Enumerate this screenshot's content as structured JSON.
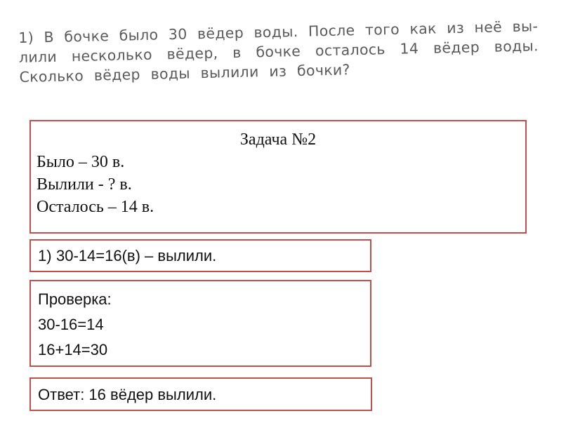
{
  "problem_text": {
    "lines": [
      [
        "1)",
        "В",
        "бочке",
        "было",
        "30",
        "вёдер",
        "воды.",
        "После",
        "того",
        "как",
        "из",
        "неё",
        "вы-"
      ],
      [
        "лили",
        "несколько",
        "вёдер,",
        "в",
        "бочке",
        "осталось",
        "14",
        "вёдер",
        "воды."
      ],
      [
        "Сколько",
        "вёдер",
        "воды",
        "вылили",
        "из",
        "бочки?"
      ]
    ]
  },
  "task_box": {
    "title": "Задача №2",
    "lines": [
      "Было – 30 в.",
      "Вылили - ? в.",
      "Осталось – 14 в."
    ]
  },
  "solution_box": {
    "step_number": "1)",
    "step_text": "30-14=16(в) – вылили."
  },
  "check_box": {
    "lines": [
      "Проверка:",
      "30-16=14",
      "16+14=30"
    ]
  },
  "answer_box": {
    "text": "Ответ: 16 вёдер вылили."
  },
  "colors": {
    "box_border": "#c0504d",
    "scan_text": "#5a5a5a"
  }
}
